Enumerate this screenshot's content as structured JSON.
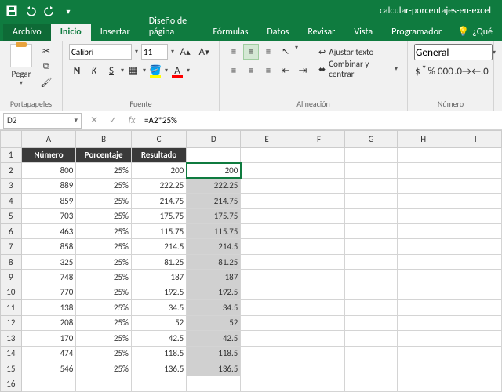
{
  "titlebar": {
    "doc_title": "calcular-porcentajes-en-excel"
  },
  "menu": {
    "file": "Archivo",
    "tabs": [
      "Inicio",
      "Insertar",
      "Diseño de página",
      "Fórmulas",
      "Datos",
      "Revisar",
      "Vista",
      "Programador"
    ],
    "active": "Inicio",
    "help": "¿Qué"
  },
  "ribbon": {
    "paste": "Pegar",
    "clipboard": "Portapapeles",
    "font_name": "Calibri",
    "font_size": "11",
    "font_group": "Fuente",
    "align_group": "Alineación",
    "wrap": "Ajustar texto",
    "merge": "Combinar y centrar",
    "number_group": "Número",
    "number_format": "General"
  },
  "formula_bar": {
    "cell_ref": "D2",
    "formula": "=A2*25%"
  },
  "sheet": {
    "columns": [
      "A",
      "B",
      "C",
      "D",
      "E",
      "F",
      "G",
      "H",
      "I"
    ],
    "headers": [
      "Número",
      "Porcentaje",
      "Resultado"
    ],
    "rows": [
      {
        "n": "800",
        "p": "25%",
        "r": "200",
        "d": "200"
      },
      {
        "n": "889",
        "p": "25%",
        "r": "222.25",
        "d": "222.25"
      },
      {
        "n": "859",
        "p": "25%",
        "r": "214.75",
        "d": "214.75"
      },
      {
        "n": "703",
        "p": "25%",
        "r": "175.75",
        "d": "175.75"
      },
      {
        "n": "463",
        "p": "25%",
        "r": "115.75",
        "d": "115.75"
      },
      {
        "n": "858",
        "p": "25%",
        "r": "214.5",
        "d": "214.5"
      },
      {
        "n": "325",
        "p": "25%",
        "r": "81.25",
        "d": "81.25"
      },
      {
        "n": "748",
        "p": "25%",
        "r": "187",
        "d": "187"
      },
      {
        "n": "770",
        "p": "25%",
        "r": "192.5",
        "d": "192.5"
      },
      {
        "n": "138",
        "p": "25%",
        "r": "34.5",
        "d": "34.5"
      },
      {
        "n": "208",
        "p": "25%",
        "r": "52",
        "d": "52"
      },
      {
        "n": "170",
        "p": "25%",
        "r": "42.5",
        "d": "42.5"
      },
      {
        "n": "474",
        "p": "25%",
        "r": "118.5",
        "d": "118.5"
      },
      {
        "n": "546",
        "p": "25%",
        "r": "136.5",
        "d": "136.5"
      }
    ]
  }
}
